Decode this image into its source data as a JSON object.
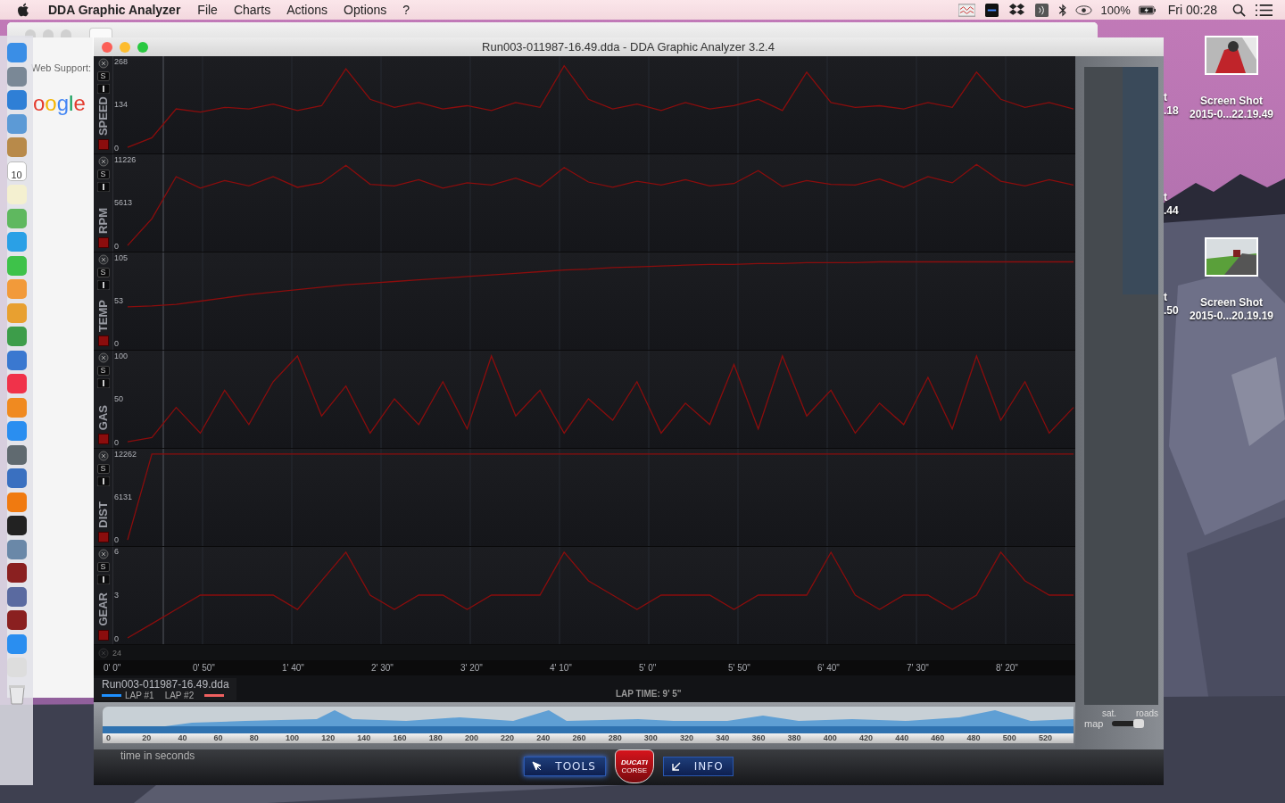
{
  "menu_bar": {
    "app_name": "DDA Graphic Analyzer",
    "menus": [
      "File",
      "Charts",
      "Actions",
      "Options",
      "?"
    ],
    "battery": "100%",
    "clock": "Fri 00:28"
  },
  "dock": {
    "calendar_day": "10"
  },
  "browser": {
    "sidebar_text": "Web Support:",
    "logo_text": "oogle"
  },
  "window": {
    "title": "Run003-011987-16.49.dda - DDA Graphic Analyzer 3.2.4"
  },
  "channels": [
    {
      "solo_label": "S",
      "chart_data": {
        "type": "line",
        "ylabel": "SPEED",
        "ylim": [
          -19.3,
          284.6
        ],
        "yticks": [
          0,
          134,
          268
        ],
        "grid": true,
        "series": [
          {
            "color": "#8b0d0d",
            "values": [
              0,
              30,
              120,
              110,
              125,
              120,
              135,
              115,
              130,
              245,
              150,
              125,
              140,
              120,
              130,
              115,
              140,
              125,
              255,
              150,
              120,
              135,
              115,
              140,
              120,
              130,
              150,
              115,
              235,
              140,
              125,
              130,
              120,
              140,
              125,
              235,
              150,
              125,
              140,
              120
            ]
          }
        ]
      }
    },
    {
      "solo_label": "S",
      "chart_data": {
        "type": "line",
        "ylabel": "RPM",
        "ylim": [
          -810,
          11921
        ],
        "yticks": [
          0,
          5613,
          11226
        ],
        "grid": true,
        "series": [
          {
            "color": "#8b0d0d",
            "values": [
              0,
              3500,
              9000,
              7500,
              8500,
              7800,
              9000,
              7600,
              8200,
              10500,
              8000,
              7800,
              8600,
              7500,
              8200,
              7900,
              8800,
              7700,
              10200,
              8300,
              7600,
              8400,
              7900,
              8600,
              7800,
              8100,
              9800,
              7700,
              8500,
              8000,
              7900,
              8700,
              7600,
              9000,
              8200,
              10600,
              8400,
              7800,
              8600,
              7900
            ]
          }
        ]
      }
    },
    {
      "solo_label": "S",
      "chart_data": {
        "type": "line",
        "ylabel": "TEMP",
        "ylim": [
          -7.6,
          111.5
        ],
        "yticks": [
          0,
          53,
          105
        ],
        "grid": true,
        "series": [
          {
            "color": "#8b0d0d",
            "values": [
              45,
              46,
              48,
              52,
              56,
              60,
              63,
              66,
              69,
              72,
              74,
              76,
              78,
              80,
              82,
              84,
              86,
              88,
              90,
              91,
              93,
              94,
              95,
              96,
              97,
              97,
              98,
              98,
              99,
              99,
              99,
              100,
              100,
              100,
              100,
              100,
              100,
              100,
              100,
              100
            ]
          }
        ]
      }
    },
    {
      "solo_label": "S",
      "chart_data": {
        "type": "line",
        "ylabel": "GAS",
        "ylim": [
          -7.2,
          106.2
        ],
        "yticks": [
          0,
          50,
          100
        ],
        "grid": true,
        "series": [
          {
            "color": "#8b0d0d",
            "values": [
              0,
              5,
              40,
              10,
              60,
              20,
              70,
              100,
              30,
              65,
              10,
              50,
              20,
              70,
              15,
              100,
              30,
              60,
              10,
              50,
              25,
              70,
              10,
              45,
              20,
              90,
              15,
              100,
              30,
              60,
              10,
              45,
              20,
              75,
              15,
              100,
              25,
              70,
              10,
              40
            ]
          }
        ]
      }
    },
    {
      "solo_label": "S",
      "chart_data": {
        "type": "line",
        "ylabel": "DIST",
        "ylim": [
          -885,
          13021
        ],
        "yticks": [
          0,
          6131,
          12262
        ],
        "grid": true,
        "series": [
          {
            "color": "#8b0d0d",
            "values": [
              0,
              12262,
              12262,
              12262,
              12262,
              12262,
              12262,
              12262,
              12262,
              12262,
              12262,
              12262,
              12262,
              12262,
              12262,
              12262,
              12262,
              12262,
              12262,
              12262,
              12262,
              12262,
              12262,
              12262,
              12262,
              12262,
              12262,
              12262,
              12262,
              12262,
              12262,
              12262,
              12262,
              12262,
              12262,
              12262,
              12262,
              12262,
              12262,
              12262
            ]
          }
        ]
      }
    },
    {
      "solo_label": "S",
      "chart_data": {
        "type": "line",
        "ylabel": "GEAR",
        "ylim": [
          -0.43,
          6.37
        ],
        "yticks": [
          0,
          3,
          6
        ],
        "grid": true,
        "series": [
          {
            "color": "#8b0d0d",
            "values": [
              0,
              1,
              2,
              3,
              3,
              3,
              3,
              2,
              4,
              6,
              3,
              2,
              3,
              3,
              2,
              3,
              3,
              3,
              6,
              4,
              3,
              2,
              3,
              3,
              3,
              2,
              3,
              3,
              3,
              6,
              3,
              2,
              3,
              3,
              2,
              3,
              6,
              4,
              3,
              3
            ]
          }
        ]
      }
    }
  ],
  "partial_channel": {
    "top_tick": "24"
  },
  "time_axis": [
    "0' 0\"",
    "0' 50\"",
    "1' 40\"",
    "2' 30\"",
    "3' 20\"",
    "4' 10\"",
    "5' 0\"",
    "5' 50\"",
    "6' 40\"",
    "7' 30\"",
    "8' 20\""
  ],
  "file_name": "Run003-011987-16.49.dda",
  "laps": [
    {
      "label": "LAP #1",
      "color": "#1e90ff"
    },
    {
      "label": "LAP #2",
      "color": "#f06060"
    }
  ],
  "lap_time": "LAP TIME: 9' 5\"",
  "timeline": {
    "ticks": [
      "0",
      "20",
      "40",
      "60",
      "80",
      "100",
      "120",
      "140",
      "160",
      "180",
      "200",
      "220",
      "240",
      "260",
      "280",
      "300",
      "320",
      "340",
      "360",
      "380",
      "400",
      "420",
      "440",
      "460",
      "480",
      "500",
      "520"
    ],
    "caption": "time in seconds"
  },
  "buttons": [
    {
      "label": "TOOLS",
      "kind": "tools"
    },
    {
      "label": "INFO",
      "kind": "info"
    }
  ],
  "logo": {
    "text": "DUCATI",
    "subtext": "CORSE"
  },
  "map_panel": {
    "options": [
      "sat.",
      "roads"
    ],
    "label": "map",
    "level": 1
  },
  "desktop_icons": [
    {
      "line1": "Screen Shot",
      "line2": "2015-0...22.19.49"
    },
    {
      "line1": "Screen Shot",
      "line2": "2015-0...20.19.19"
    }
  ],
  "partial_desktop_labels": [
    {
      "line1": "t",
      "line2": ".18"
    },
    {
      "line1": "t",
      "line2": ".44"
    },
    {
      "line1": "t",
      "line2": ".50"
    }
  ]
}
